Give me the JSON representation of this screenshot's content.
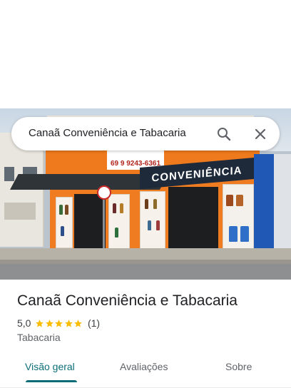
{
  "search": {
    "query": "Canaã Conveniência e Tabacaria",
    "search_icon": "search-icon",
    "close_icon": "close-icon"
  },
  "hero": {
    "sign_text": "CONVENIÊNCIA",
    "phone_text": "69 9 9243-6361"
  },
  "place": {
    "name": "Canaã Conveniência e Tabacaria",
    "rating": "5,0",
    "stars": 5,
    "review_count": "(1)",
    "category": "Tabacaria",
    "star_color": "#fbbc04"
  },
  "tabs": [
    {
      "label": "Visão geral",
      "active": true
    },
    {
      "label": "Avaliações",
      "active": false
    },
    {
      "label": "Sobre",
      "active": false
    }
  ],
  "colors": {
    "accent": "#0b6e77",
    "star": "#fbbc04"
  }
}
